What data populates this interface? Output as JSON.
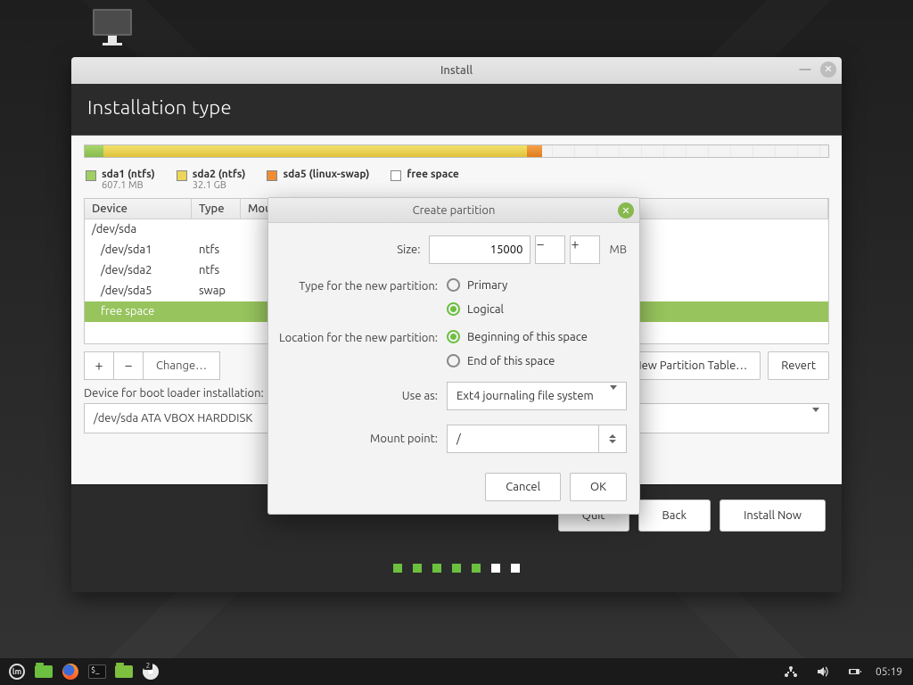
{
  "window": {
    "title": "Install",
    "heading": "Installation type"
  },
  "legend": [
    {
      "swatch": "sw-green",
      "name": "sda1 (ntfs)",
      "sub": "607.1 MB"
    },
    {
      "swatch": "sw-yellow",
      "name": "sda2 (ntfs)",
      "sub": "32.1 GB"
    },
    {
      "swatch": "sw-orange",
      "name": "sda5 (linux-swap)",
      "sub": ""
    },
    {
      "swatch": "sw-white",
      "name": "free space",
      "sub": ""
    }
  ],
  "usage_bar": [
    {
      "class": "grad-green",
      "width_pct": 2.5
    },
    {
      "class": "grad-yellow",
      "width_pct": 57.0
    },
    {
      "class": "grad-orange",
      "width_pct": 2.0
    },
    {
      "class": "spacer-grid",
      "width_pct": 38.5
    }
  ],
  "table": {
    "columns": {
      "device": "Device",
      "type": "Type",
      "mount": "Mount point"
    },
    "rows": [
      {
        "device": "/dev/sda",
        "type": "",
        "indent": 0,
        "selected": false
      },
      {
        "device": "/dev/sda1",
        "type": "ntfs",
        "indent": 1,
        "selected": false
      },
      {
        "device": "/dev/sda2",
        "type": "ntfs",
        "indent": 1,
        "selected": false
      },
      {
        "device": "/dev/sda5",
        "type": "swap",
        "indent": 1,
        "selected": false
      },
      {
        "device": "free space",
        "type": "",
        "indent": 1,
        "selected": true
      }
    ]
  },
  "table_buttons": {
    "add": "+",
    "remove": "−",
    "change": "Change…",
    "new_table": "New Partition Table…",
    "revert": "Revert"
  },
  "bootloader": {
    "label": "Device for boot loader installation:",
    "value": "/dev/sda   ATA VBOX HARDDISK"
  },
  "nav": {
    "quit": "Quit",
    "back": "Back",
    "install": "Install Now"
  },
  "pager": {
    "total": 7,
    "green": 5
  },
  "dialog": {
    "title": "Create partition",
    "size_label": "Size:",
    "size_value": "15000",
    "size_unit": "MB",
    "type_label": "Type for the new partition:",
    "type_primary": "Primary",
    "type_logical": "Logical",
    "type_selected": "logical",
    "location_label": "Location for the new partition:",
    "location_begin": "Beginning of this space",
    "location_end": "End of this space",
    "location_selected": "begin",
    "useas_label": "Use as:",
    "useas_value": "Ext4 journaling file system",
    "mount_label": "Mount point:",
    "mount_value": "/",
    "cancel": "Cancel",
    "ok": "OK"
  },
  "taskbar": {
    "clock": "05:19",
    "running_badge": "2"
  }
}
